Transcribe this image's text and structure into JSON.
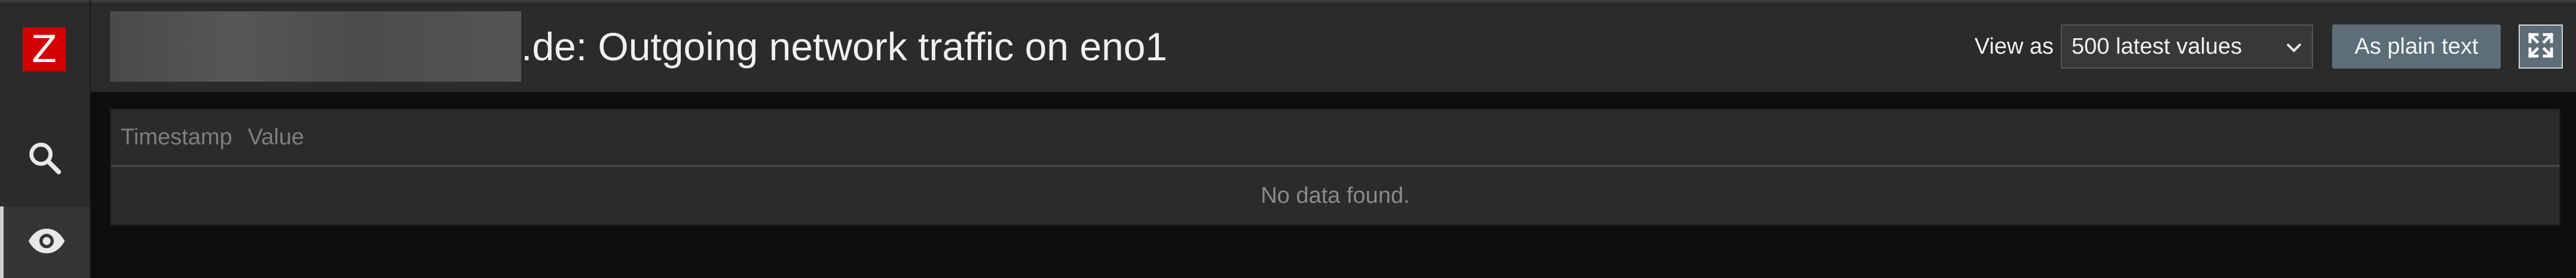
{
  "sidebar": {
    "logo_letter": "Z",
    "items": [
      {
        "name": "search",
        "icon": "search-icon"
      },
      {
        "name": "monitoring",
        "icon": "eye-icon"
      }
    ]
  },
  "header": {
    "title": ".de: Outgoing network traffic on eno1",
    "view_as_label": "View as",
    "view_as_selected": "500 latest values",
    "plain_text_button": "As plain text",
    "fullscreen_icon": "fullscreen-icon"
  },
  "table": {
    "columns": [
      "Timestamp",
      "Value"
    ],
    "empty_message": "No data found."
  },
  "colors": {
    "accent_logo": "#d40000",
    "button": "#5d6e78",
    "background": "#0e0e0e",
    "panel": "#2b2b2b"
  }
}
